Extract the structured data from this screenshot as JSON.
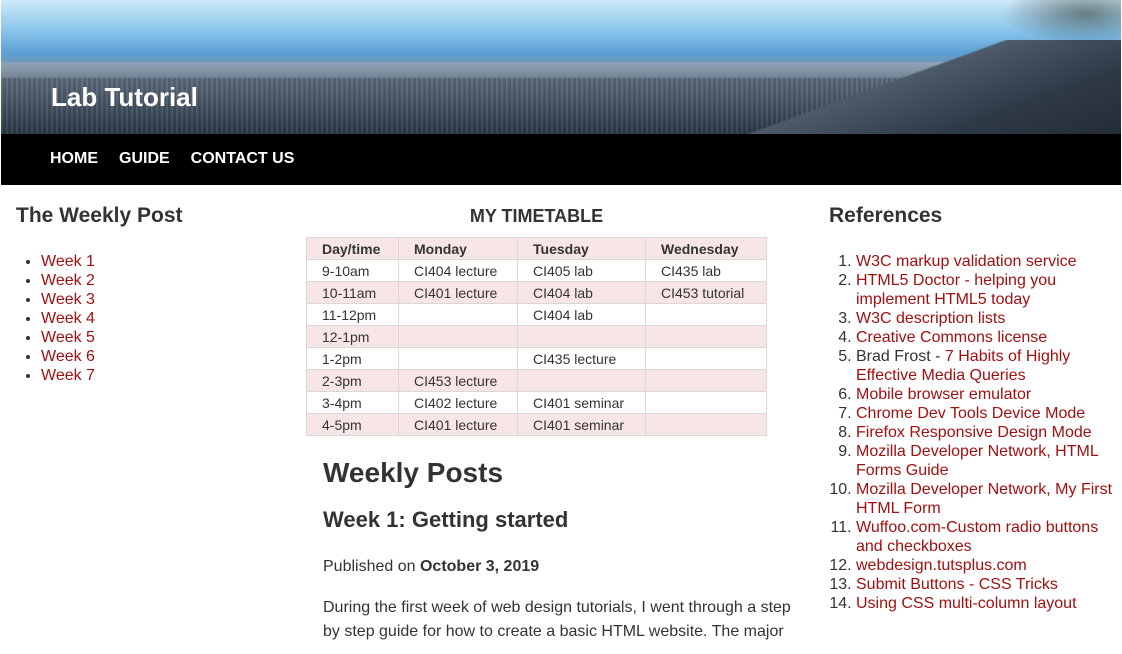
{
  "site": {
    "title": "Lab Tutorial"
  },
  "nav": [
    "HOME",
    "GUIDE",
    "CONTACT US"
  ],
  "left": {
    "heading": "The Weekly Post",
    "weeks": [
      "Week 1",
      "Week 2",
      "Week 3",
      "Week 4",
      "Week 5",
      "Week 6",
      "Week 7"
    ]
  },
  "timetable": {
    "title": "MY TIMETABLE",
    "headers": [
      "Day/time",
      "Monday",
      "Tuesday",
      "Wednesday"
    ],
    "rows": [
      [
        "9-10am",
        "CI404 lecture",
        "CI405 lab",
        "CI435 lab"
      ],
      [
        "10-11am",
        "CI401 lecture",
        "CI404 lab",
        "CI453 tutorial"
      ],
      [
        "11-12pm",
        "",
        "CI404 lab",
        ""
      ],
      [
        "12-1pm",
        "",
        "",
        ""
      ],
      [
        "1-2pm",
        "",
        "CI435 lecture",
        ""
      ],
      [
        "2-3pm",
        "CI453 lecture",
        "",
        ""
      ],
      [
        "3-4pm",
        "CI402 lecture",
        "CI401 seminar",
        ""
      ],
      [
        "4-5pm",
        "CI401 lecture",
        "CI401 seminar",
        ""
      ]
    ]
  },
  "posts": {
    "heading": "Weekly Posts",
    "post_title": "Week 1: Getting started",
    "published_prefix": "Published on",
    "published_date": "October 3, 2019",
    "paragraph": "During the first week of web design tutorials, I went through a step by step guide for how to create a basic HTML website. The major"
  },
  "right": {
    "heading": "References",
    "refs": [
      {
        "link": "W3C markup validation service"
      },
      {
        "link": "HTML5 Doctor - helping you implement HTML5 today"
      },
      {
        "link": "W3C description lists"
      },
      {
        "link": "Creative Commons license"
      },
      {
        "prefix": "Brad Frost - ",
        "link": "7 Habits of Highly Effective Media Queries"
      },
      {
        "link": "Mobile browser emulator"
      },
      {
        "link": "Chrome Dev Tools Device Mode"
      },
      {
        "link": "Firefox Responsive Design Mode"
      },
      {
        "link": "Mozilla Developer Network, HTML Forms Guide"
      },
      {
        "link": "Mozilla Developer Network, My First HTML Form"
      },
      {
        "link": "Wuffoo.com-Custom radio buttons and checkboxes"
      },
      {
        "link": "webdesign.tutsplus.com"
      },
      {
        "link": "Submit Buttons - CSS Tricks"
      },
      {
        "link": "Using CSS multi-column layout"
      }
    ]
  },
  "colors": {
    "link": "#a01010",
    "nav_bg": "#000000",
    "row_alt": "#f8e6e6"
  }
}
